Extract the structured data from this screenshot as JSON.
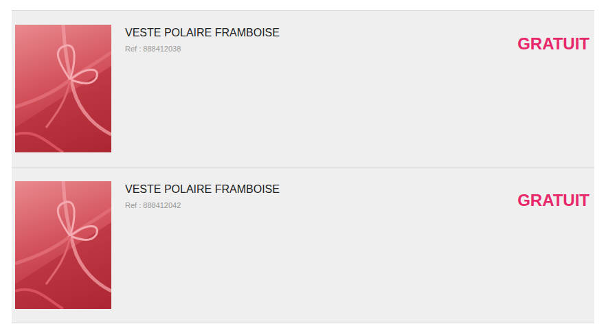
{
  "items": [
    {
      "title": "VESTE POLAIRE FRAMBOISE",
      "ref": "Ref : 888412038",
      "price": "GRATUIT"
    },
    {
      "title": "VESTE POLAIRE FRAMBOISE",
      "ref": "Ref : 888412042",
      "price": "GRATUIT"
    }
  ]
}
